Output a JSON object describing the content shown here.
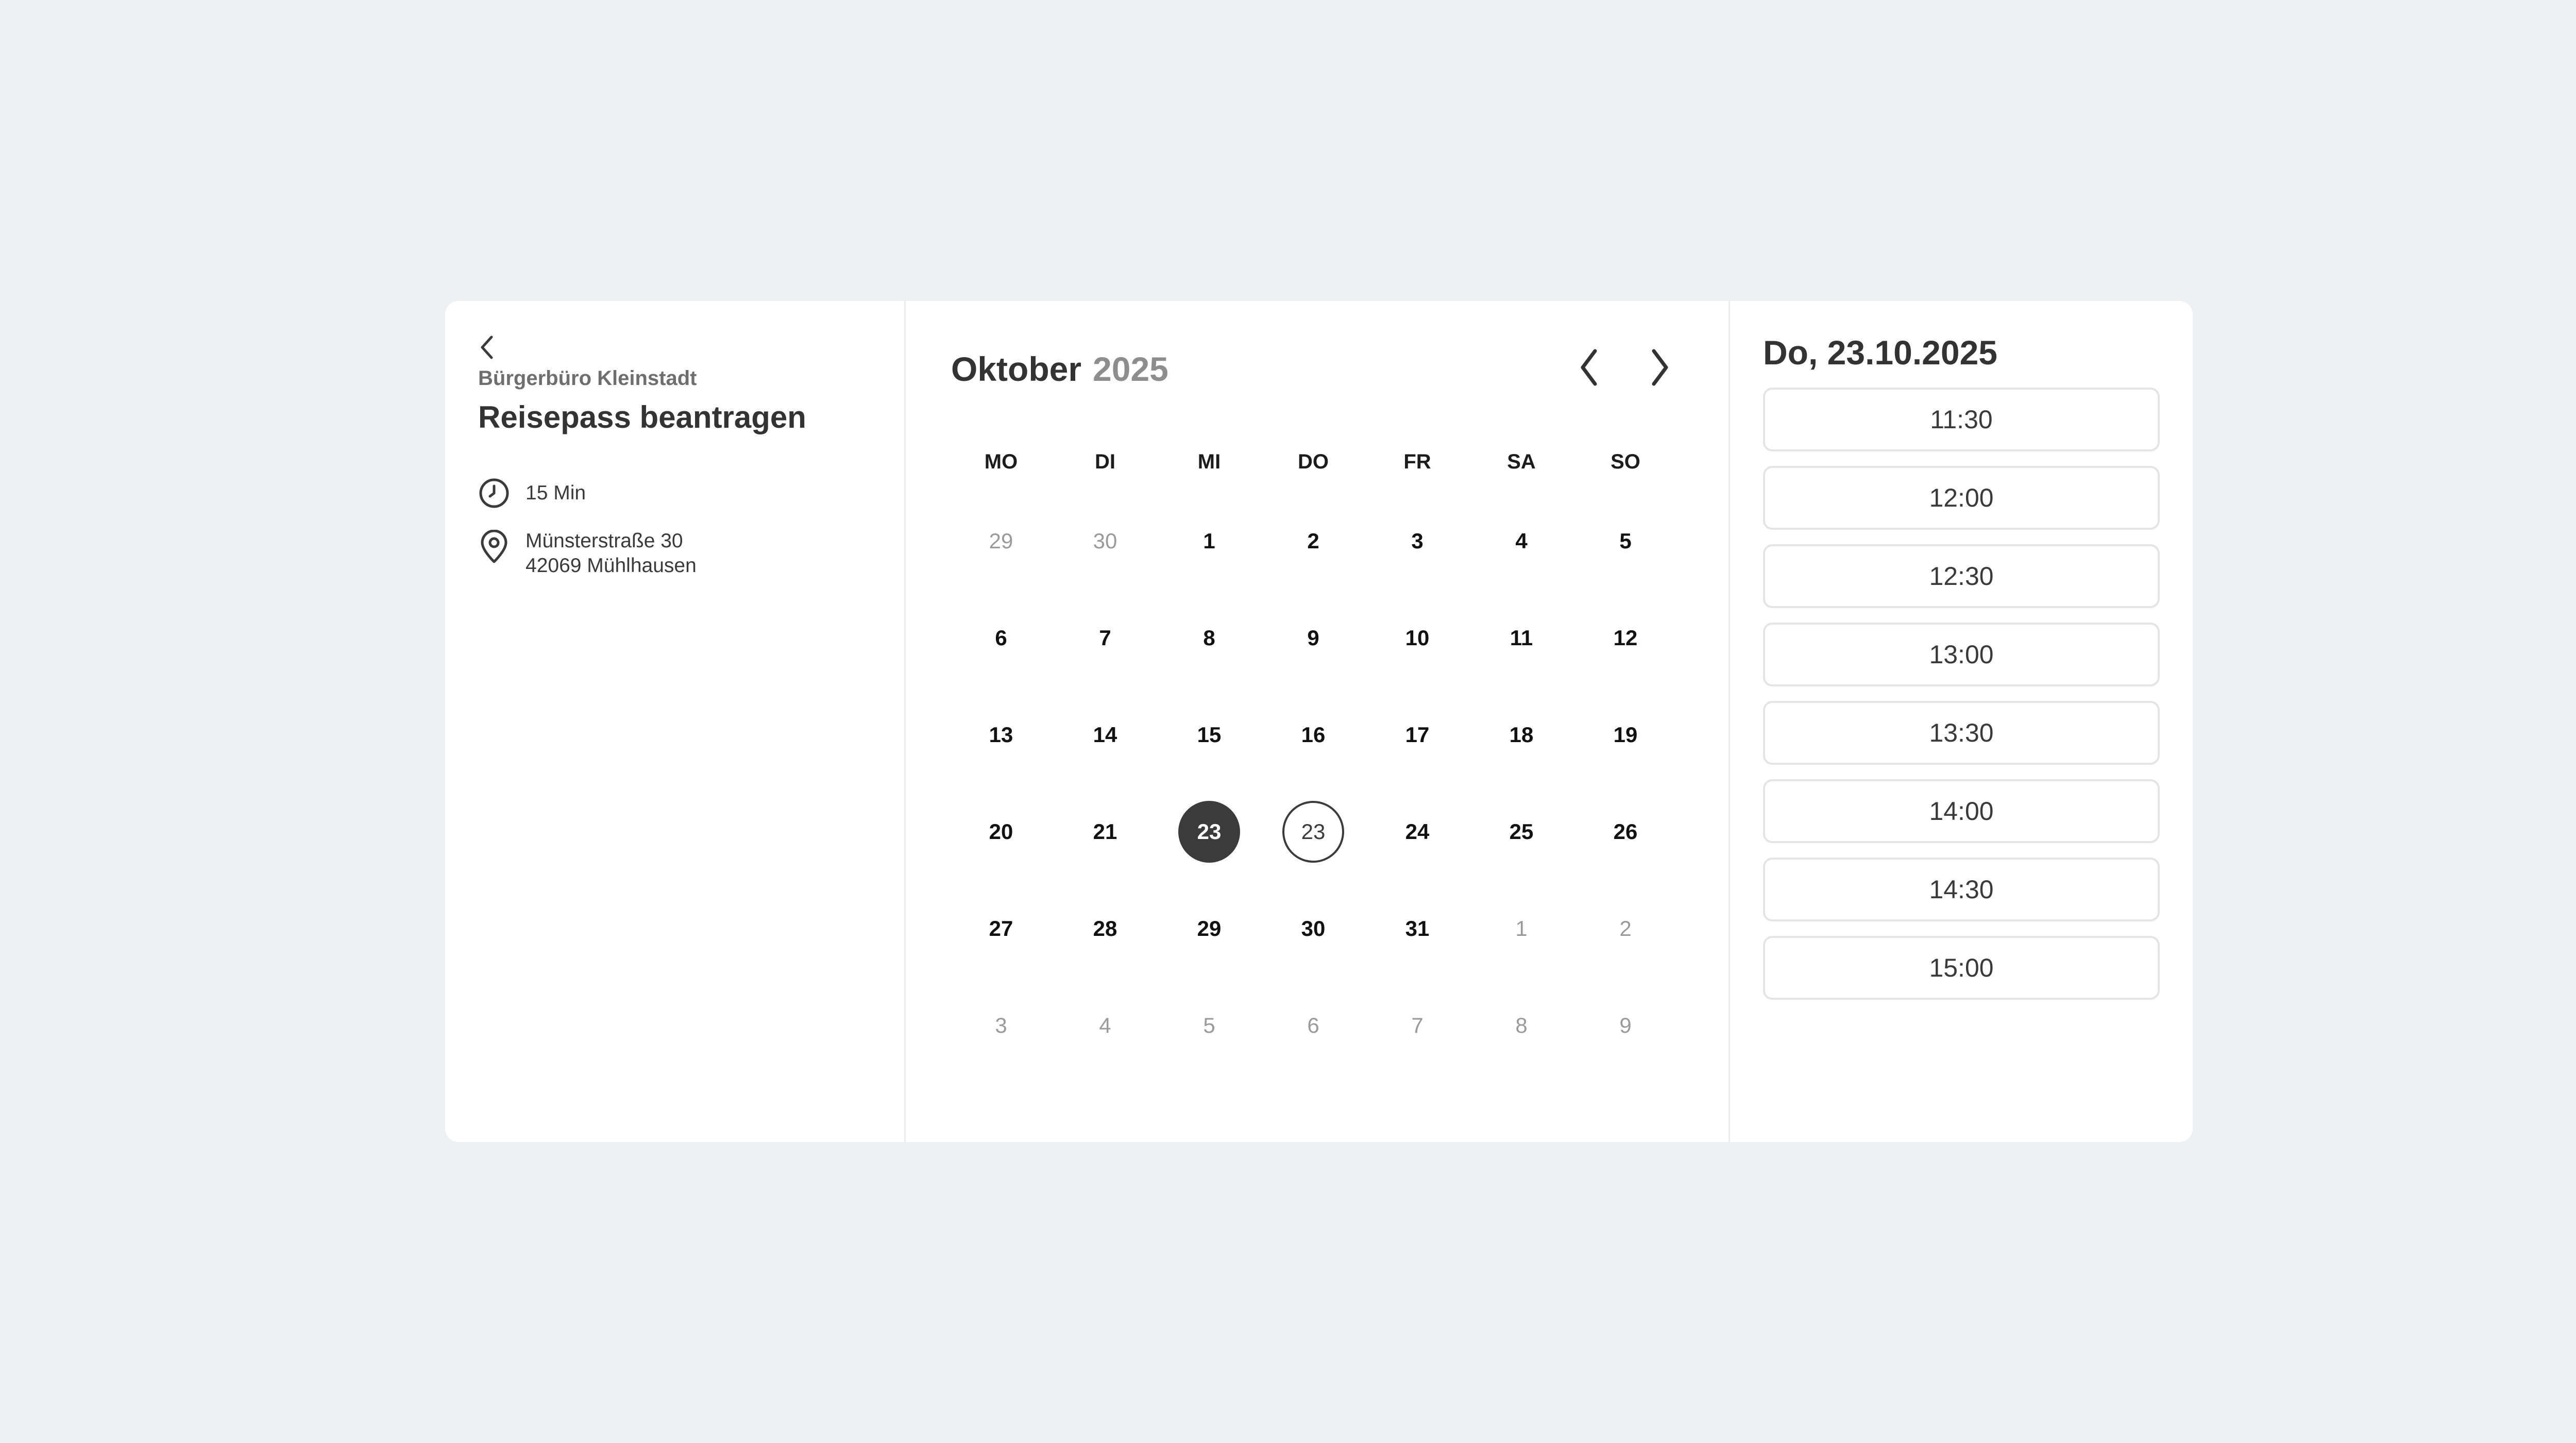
{
  "service_panel": {
    "back_icon": "chevron-left-icon",
    "organization": "Bürgerbüro Kleinstadt",
    "service_title": "Reisepass beantragen",
    "duration": {
      "icon": "clock-icon",
      "text": "15 Min"
    },
    "address": {
      "icon": "map-pin-icon",
      "line1": "Münsterstraße 30",
      "line2": "42069 Mühlhausen"
    }
  },
  "calendar": {
    "month": "Oktober",
    "year": "2025",
    "prev_icon": "chevron-left-icon",
    "next_icon": "chevron-right-icon",
    "weekdays": [
      "MO",
      "DI",
      "MI",
      "DO",
      "FR",
      "SA",
      "SO"
    ],
    "weeks": [
      [
        {
          "d": "29",
          "m": true
        },
        {
          "d": "30",
          "m": true
        },
        {
          "d": "1"
        },
        {
          "d": "2"
        },
        {
          "d": "3"
        },
        {
          "d": "4"
        },
        {
          "d": "5"
        }
      ],
      [
        {
          "d": "6"
        },
        {
          "d": "7"
        },
        {
          "d": "8"
        },
        {
          "d": "9"
        },
        {
          "d": "10"
        },
        {
          "d": "11"
        },
        {
          "d": "12"
        }
      ],
      [
        {
          "d": "13"
        },
        {
          "d": "14"
        },
        {
          "d": "15"
        },
        {
          "d": "16"
        },
        {
          "d": "17"
        },
        {
          "d": "18"
        },
        {
          "d": "19"
        }
      ],
      [
        {
          "d": "20"
        },
        {
          "d": "21"
        },
        {
          "d": "23",
          "s": "selected"
        },
        {
          "d": "23",
          "s": "today"
        },
        {
          "d": "24"
        },
        {
          "d": "25"
        },
        {
          "d": "26"
        }
      ],
      [
        {
          "d": "27"
        },
        {
          "d": "28"
        },
        {
          "d": "29"
        },
        {
          "d": "30"
        },
        {
          "d": "31"
        },
        {
          "d": "1",
          "m": true
        },
        {
          "d": "2",
          "m": true
        }
      ],
      [
        {
          "d": "3",
          "m": true
        },
        {
          "d": "4",
          "m": true
        },
        {
          "d": "5",
          "m": true
        },
        {
          "d": "6",
          "m": true
        },
        {
          "d": "7",
          "m": true
        },
        {
          "d": "8",
          "m": true
        },
        {
          "d": "9",
          "m": true
        }
      ]
    ]
  },
  "timeslots": {
    "date_title": "Do, 23.10.2025",
    "slots": [
      "11:30",
      "12:00",
      "12:30",
      "13:00",
      "13:30",
      "14:00",
      "14:30",
      "15:00"
    ]
  },
  "colors": {
    "background": "#eeeff2",
    "card": "#ffffff",
    "selected_day": "#3b3b3b",
    "muted_text": "#9a9a9a"
  }
}
